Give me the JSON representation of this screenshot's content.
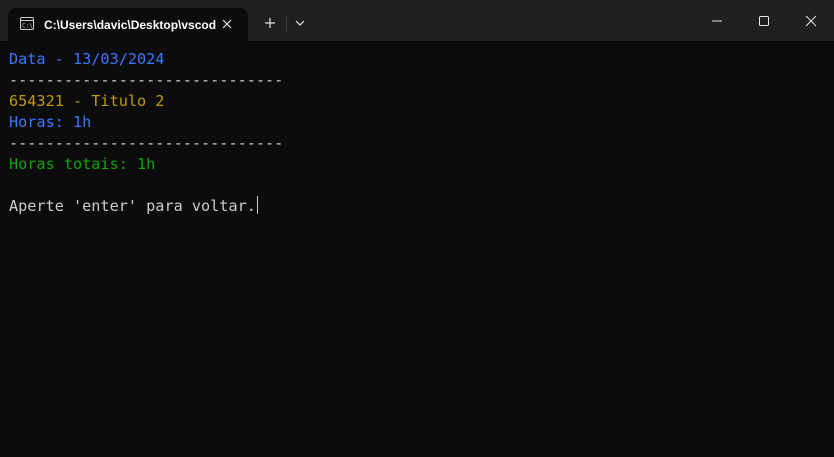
{
  "window": {
    "tab_title": "C:\\Users\\davic\\Desktop\\vscode",
    "icons": {
      "tab": "terminal-icon",
      "close_tab": "close-icon",
      "new_tab": "plus-icon",
      "dropdown": "chevron-down-icon",
      "minimize": "minimize-icon",
      "maximize": "maximize-icon",
      "close": "close-icon"
    }
  },
  "colors": {
    "background": "#0c0c0c",
    "titlebar": "#202020",
    "blue": "#3b78ff",
    "yellow": "#c19c00",
    "green": "#13a10e",
    "gray": "#cccccc"
  },
  "terminal": {
    "lines": [
      {
        "text": "Data - 13/03/2024",
        "color": "blue"
      },
      {
        "text": "------------------------------",
        "color": "gray"
      },
      {
        "text": "654321 - Titulo 2",
        "color": "yellow"
      },
      {
        "text": "Horas: 1h",
        "color": "blue"
      },
      {
        "text": "------------------------------",
        "color": "gray"
      },
      {
        "text": "Horas totais: 1h",
        "color": "green"
      },
      {
        "text": "",
        "color": "gray"
      },
      {
        "text": "Aperte 'enter' para voltar.",
        "color": "gray"
      }
    ]
  }
}
